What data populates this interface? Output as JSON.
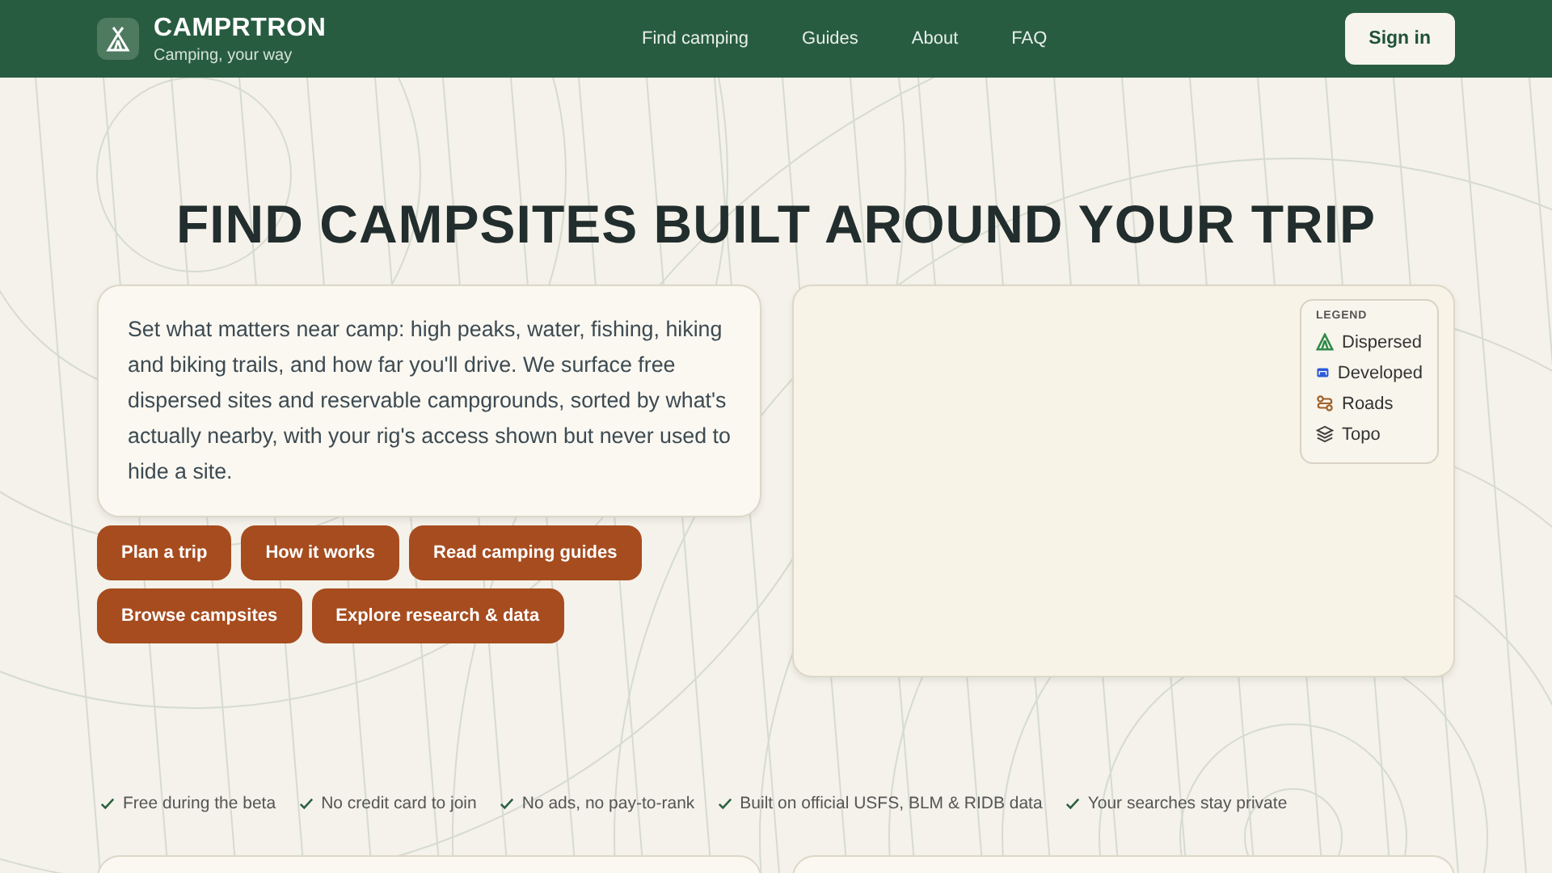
{
  "header": {
    "brand": "CAMPRTRON",
    "tagline": "Camping, your way",
    "nav": [
      "Find camping",
      "Guides",
      "About",
      "FAQ"
    ],
    "sign_in": "Sign in"
  },
  "hero": {
    "title": "FIND CAMPSITES BUILT AROUND YOUR TRIP",
    "intro": "Set what matters near camp: high peaks, water, fishing, hiking and biking trails, and how far you'll drive. We surface free dispersed sites and reservable campgrounds, sorted by what's actually nearby, with your rig's access shown but never used to hide a site.",
    "buttons": [
      [
        "Plan a trip",
        "How it works",
        "Read camping guides"
      ],
      [
        "Browse campsites",
        "Explore research & data"
      ]
    ]
  },
  "map": {
    "legend": {
      "title": "LEGEND",
      "items": [
        {
          "kind": "tent",
          "label": "Dispersed"
        },
        {
          "kind": "building",
          "label": "Developed"
        },
        {
          "kind": "road",
          "label": "Roads"
        },
        {
          "kind": "layers",
          "label": "Topo"
        }
      ]
    }
  },
  "benefits": [
    "Free during the beta",
    "No credit card to join",
    "No ads, no pay-to-rank",
    "Built on official USFS, BLM & RIDB data",
    "Your searches stay private"
  ]
}
